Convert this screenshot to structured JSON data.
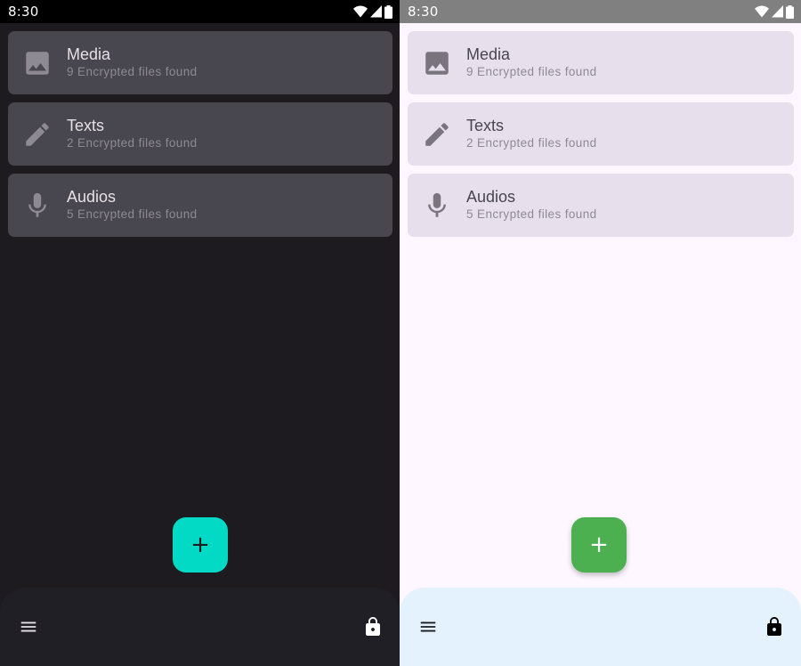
{
  "status_bar": {
    "time": "8:30"
  },
  "categories": [
    {
      "title": "Media",
      "subtitle": "9 Encrypted files found",
      "icon": "image-icon"
    },
    {
      "title": "Texts",
      "subtitle": "2 Encrypted files found",
      "icon": "pencil-icon"
    },
    {
      "title": "Audios",
      "subtitle": "5 Encrypted files found",
      "icon": "microphone-icon"
    }
  ],
  "fab": {
    "label": "+"
  },
  "bottom_bar": {
    "menu_icon": "menu-icon",
    "lock_icon": "lock-icon"
  },
  "themes": {
    "dark": {
      "background": "#1d1b20",
      "card": "#48464f",
      "fab": "#03dac5",
      "bottom_bar": "#211f26"
    },
    "light": {
      "background": "#fef7ff",
      "card": "#e7e0ec",
      "fab": "#4caf50",
      "bottom_bar": "#e3f2fd"
    }
  }
}
